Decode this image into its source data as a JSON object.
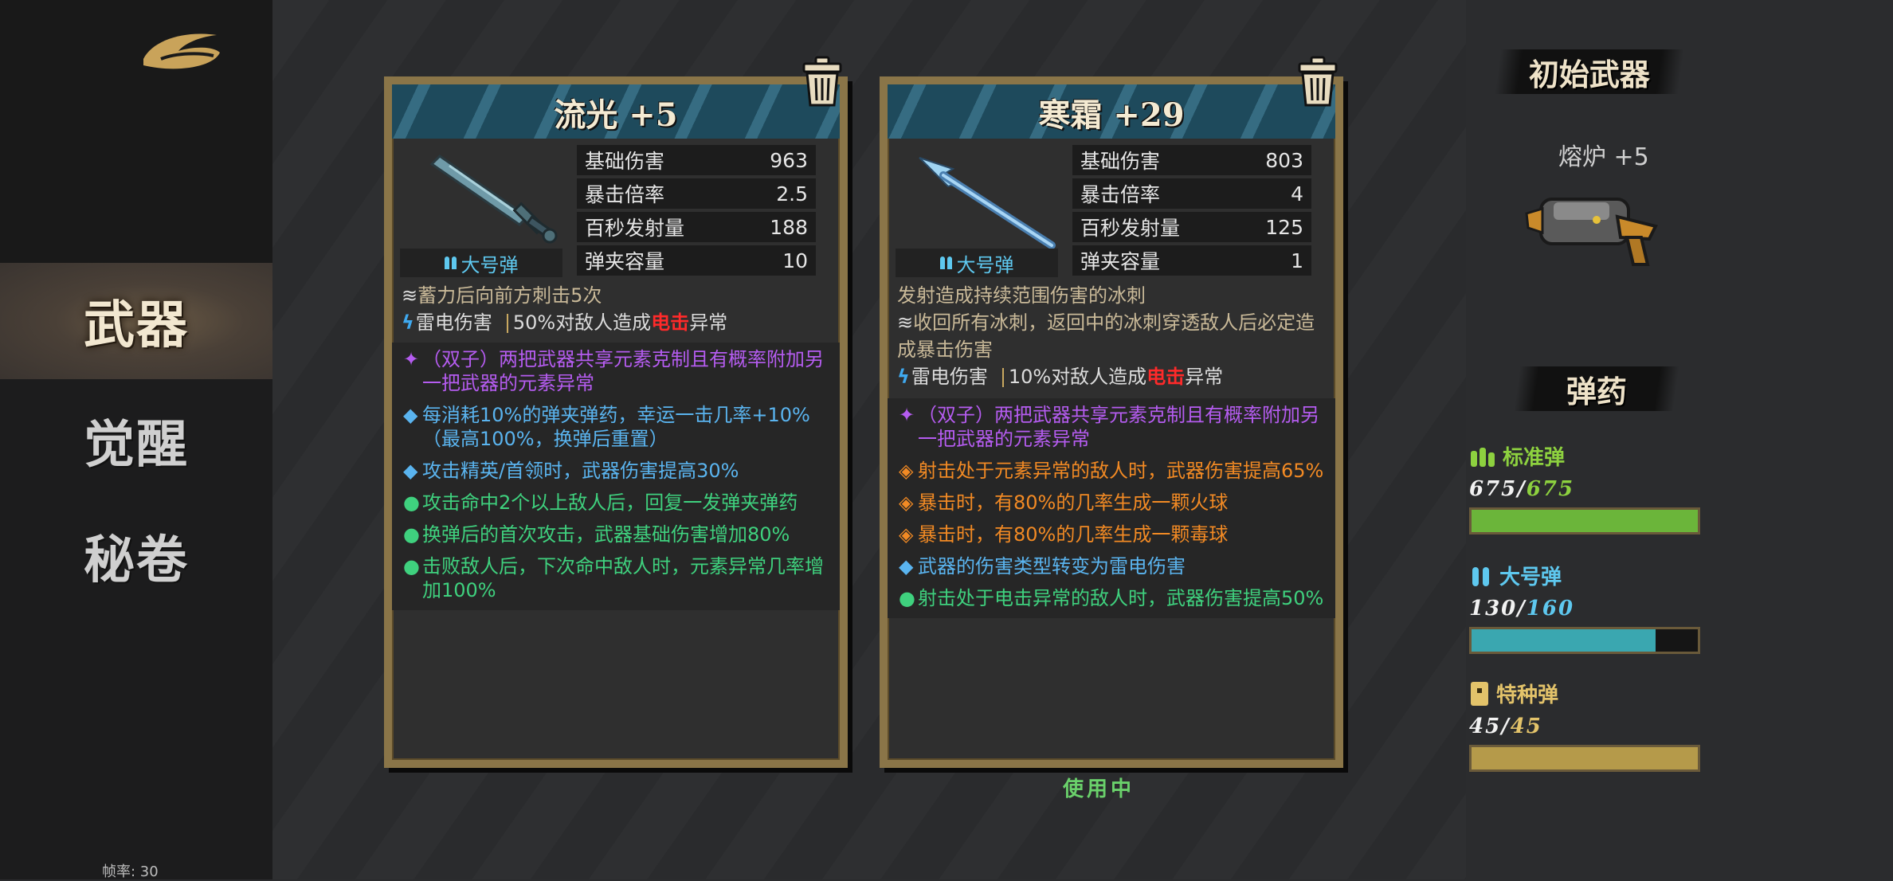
{
  "sidebar": {
    "nav": [
      {
        "label": "武器",
        "active": true
      },
      {
        "label": "觉醒",
        "active": false
      },
      {
        "label": "秘卷",
        "active": false
      }
    ],
    "fps_text": "帧率: 30"
  },
  "weapons": [
    {
      "title": "流光 +5",
      "ammo_type": "大号弹",
      "stats": [
        {
          "label": "基础伤害",
          "value": "963"
        },
        {
          "label": "暴击倍率",
          "value": "2.5"
        },
        {
          "label": "百秒发射量",
          "value": "188"
        },
        {
          "label": "弹夹容量",
          "value": "10"
        }
      ],
      "charge_desc": "蓄力后向前方刺击5次",
      "element_label": "雷电伤害",
      "element_pre": "50%对敌人造成",
      "element_red": "电击",
      "element_post": "异常",
      "traits": [
        {
          "bullet": "✦",
          "color": "purple",
          "text": "（双子）两把武器共享元素克制且有概率附加另一把武器的元素异常"
        },
        {
          "bullet": "◆",
          "color": "blue",
          "text": "每消耗10%的弹夹弹药，幸运一击几率+10%（最高100%，换弹后重置）"
        },
        {
          "bullet": "◆",
          "color": "blue",
          "text": "攻击精英/首领时，武器伤害提高30%"
        },
        {
          "bullet": "●",
          "color": "green",
          "text": "攻击命中2个以上敌人后，回复一发弹夹弹药"
        },
        {
          "bullet": "●",
          "color": "green",
          "text": "换弹后的首次攻击，武器基础伤害增加80%"
        },
        {
          "bullet": "●",
          "color": "green",
          "text": "击败敌人后，下次命中敌人时，元素异常几率增加100%"
        }
      ]
    },
    {
      "title": "寒霜 +29",
      "ammo_type": "大号弹",
      "stats": [
        {
          "label": "基础伤害",
          "value": "803"
        },
        {
          "label": "暴击倍率",
          "value": "4"
        },
        {
          "label": "百秒发射量",
          "value": "125"
        },
        {
          "label": "弹夹容量",
          "value": "1"
        }
      ],
      "fire_desc": "发射造成持续范围伤害的冰刺",
      "recall_desc": "收回所有冰刺，返回中的冰刺穿透敌人后必定造成暴击伤害",
      "element_label": "雷电伤害",
      "element_pre": "10%对敌人造成",
      "element_red": "电击",
      "element_post": "异常",
      "traits": [
        {
          "bullet": "✦",
          "color": "purple",
          "text": "（双子）两把武器共享元素克制且有概率附加另一把武器的元素异常"
        },
        {
          "bullet": "◈",
          "color": "orange",
          "text": "射击处于元素异常的敌人时，武器伤害提高65%"
        },
        {
          "bullet": "◈",
          "color": "orange",
          "text": "暴击时，有80%的几率生成一颗火球"
        },
        {
          "bullet": "◈",
          "color": "orange",
          "text": "暴击时，有80%的几率生成一颗毒球"
        },
        {
          "bullet": "◆",
          "color": "blue",
          "text": "武器的伤害类型转变为雷电伤害"
        },
        {
          "bullet": "●",
          "color": "green",
          "text": "射击处于电击异常的敌人时，武器伤害提高50%"
        }
      ],
      "status": "使用中"
    }
  ],
  "right_panel": {
    "start_weapon_title": "初始武器",
    "start_weapon_name": "熔炉 +5",
    "ammo_title": "弹药",
    "ammo": [
      {
        "name": "标准弹",
        "current": "675",
        "max": "675",
        "fill": 1.0,
        "name_color": "#8dd13f",
        "count_color": "#8dd13f",
        "bar_color": "#6bb53a"
      },
      {
        "name": "大号弹",
        "current": "130",
        "max": "160",
        "fill": 0.8125,
        "name_color": "#5ec8ef",
        "count_color": "#5ec8ef",
        "bar_color": "#3aa7b0"
      },
      {
        "name": "特种弹",
        "current": "45",
        "max": "45",
        "fill": 1.0,
        "name_color": "#e3c36a",
        "count_color": "#e3c36a",
        "bar_color": "#b59a4a"
      }
    ]
  }
}
